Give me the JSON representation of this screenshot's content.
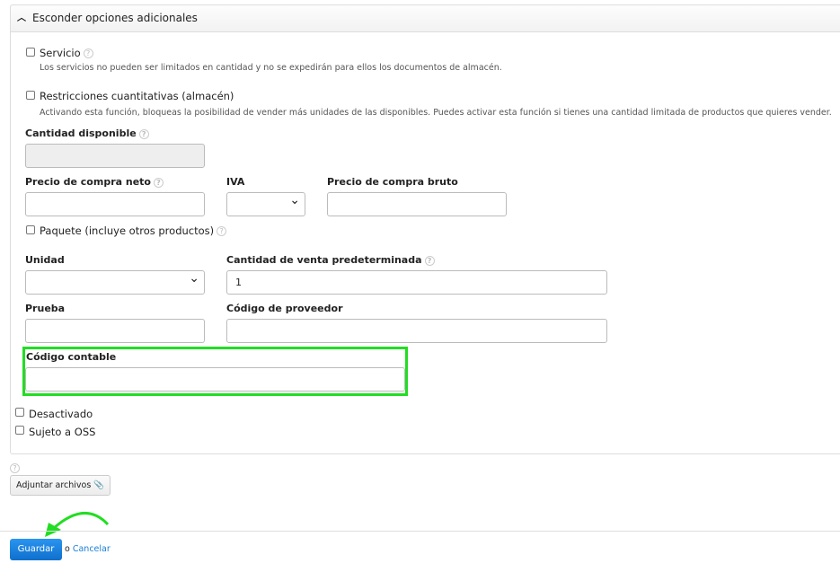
{
  "header": {
    "toggle_label": "Esconder opciones adicionales"
  },
  "servicio": {
    "label": "Servicio",
    "desc": "Los servicios no pueden ser limitados en cantidad y no se expedirán para ellos los documentos de almacén."
  },
  "restricciones": {
    "label": "Restricciones cuantitativas (almacén)",
    "desc": "Activando esta función, bloqueas la posibilidad de vender más unidades de las disponibles. Puedes activar esta función si tienes una cantidad limitada de productos que quieres vender."
  },
  "fields": {
    "cantidad_disponible": "Cantidad disponible",
    "precio_neto": "Precio de compra neto",
    "iva": "IVA",
    "precio_bruto": "Precio de compra bruto",
    "paquete": "Paquete (incluye otros productos)",
    "unidad": "Unidad",
    "cantidad_venta": "Cantidad de venta predeterminada",
    "cantidad_venta_value": "1",
    "prueba": "Prueba",
    "codigo_proveedor": "Código de proveedor",
    "codigo_contable": "Código contable",
    "desactivado": "Desactivado",
    "oss": "Sujeto a OSS"
  },
  "help": "?",
  "attach_label": "Adjuntar archivos",
  "footer": {
    "save": "Guardar",
    "or": "o",
    "cancel": "Cancelar"
  },
  "colors": {
    "highlight": "#22dd22",
    "primary": "#1a7fd6"
  }
}
